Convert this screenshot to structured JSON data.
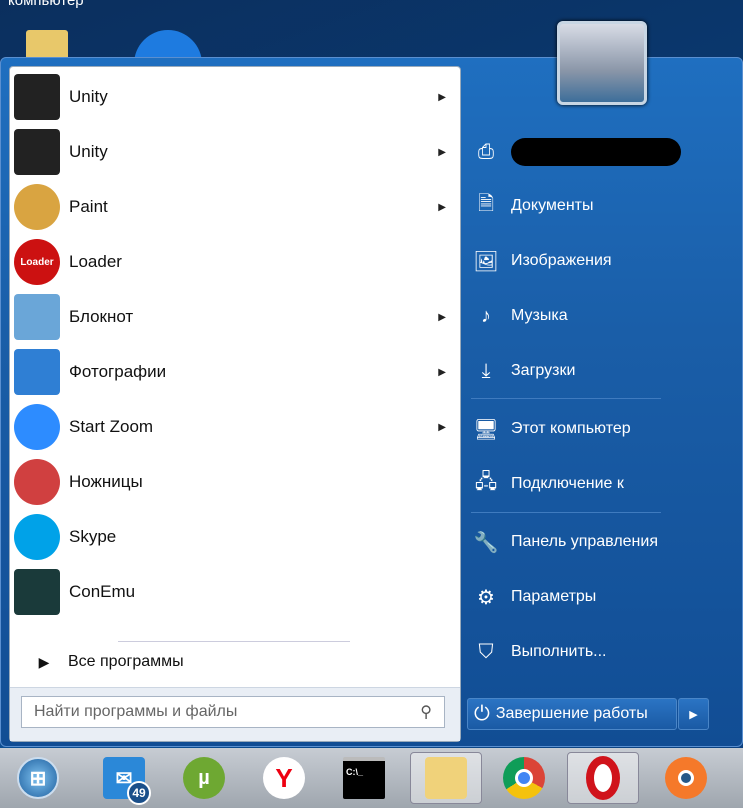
{
  "desktop": {
    "top_text": "компьютер"
  },
  "programs": [
    {
      "label": "Unity",
      "icon": "unity-icon",
      "submenu": true,
      "color": "#222222"
    },
    {
      "label": "Unity",
      "icon": "unity-icon",
      "submenu": true,
      "color": "#222222"
    },
    {
      "label": "Paint",
      "icon": "paint-palette-icon",
      "submenu": true,
      "color": "#d9a441"
    },
    {
      "label": "Loader",
      "icon": "loader-icon",
      "submenu": false,
      "color": "#cc1111"
    },
    {
      "label": "Блокнот",
      "icon": "notepad-icon",
      "submenu": true,
      "color": "#6aa6d8"
    },
    {
      "label": "Фотографии",
      "icon": "photos-icon",
      "submenu": true,
      "color": "#2f7fd4"
    },
    {
      "label": "Start Zoom",
      "icon": "zoom-icon",
      "submenu": true,
      "color": "#2d8cff"
    },
    {
      "label": "Ножницы",
      "icon": "scissors-icon",
      "submenu": false,
      "color": "#d04040"
    },
    {
      "label": "Skype",
      "icon": "skype-icon",
      "submenu": false,
      "color": "#00a2e8"
    },
    {
      "label": "ConEmu",
      "icon": "conemu-icon",
      "submenu": false,
      "color": "#1a3a3a"
    }
  ],
  "loader_icon_text": "Loader",
  "all_programs": "Все программы",
  "search": {
    "placeholder": "Найти программы и файлы"
  },
  "right": [
    {
      "label": "Документы",
      "icon": "document-icon"
    },
    {
      "label": "Изображения",
      "icon": "image-icon"
    },
    {
      "label": "Музыка",
      "icon": "music-icon"
    },
    {
      "label": "Загрузки",
      "icon": "download-icon"
    },
    {
      "label": "Этот компьютер",
      "icon": "computer-icon"
    },
    {
      "label": "Подключение к",
      "icon": "network-icon"
    },
    {
      "label": "Панель управления",
      "icon": "wrench-icon"
    },
    {
      "label": "Параметры",
      "icon": "gear-icon"
    },
    {
      "label": "Выполнить...",
      "icon": "run-icon"
    }
  ],
  "shutdown": {
    "label": "Завершение работы"
  },
  "taskbar": {
    "mail_badge": "49",
    "cmd_text": "C:\\_"
  }
}
